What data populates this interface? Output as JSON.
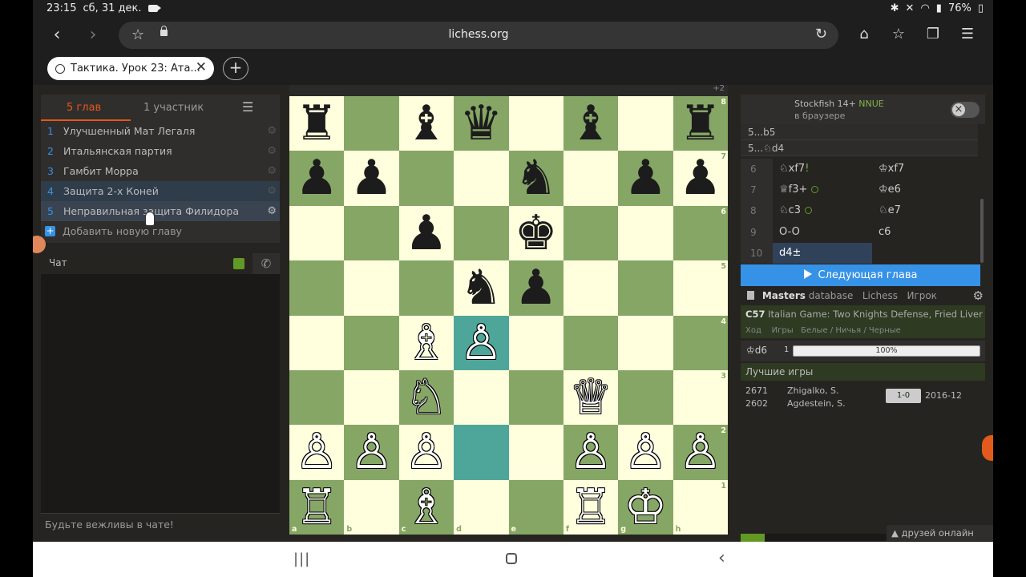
{
  "status": {
    "time": "23:15",
    "date": "сб, 31 дек.",
    "battery": "76%",
    "icons": [
      "bluetooth-icon",
      "mute-icon",
      "wifi-icon",
      "signal-icon",
      "battery-icon"
    ]
  },
  "browser": {
    "url": "lichess.org",
    "tab_title": "Тактика. Урок 23: Ата...",
    "close_glyph": "✕",
    "newtab_glyph": "+"
  },
  "study": {
    "tab_chapters": "5 глав",
    "tab_members": "1 участник",
    "chapters": [
      {
        "num": "1",
        "label": "Улучшенный Мат Легаля"
      },
      {
        "num": "2",
        "label": "Итальянская партия"
      },
      {
        "num": "3",
        "label": "Гамбит Морра"
      },
      {
        "num": "4",
        "label": "Защита 2-х Коней"
      },
      {
        "num": "5",
        "label": "Неправильная защита Филидора"
      }
    ],
    "add_chapter": "Добавить новую главу"
  },
  "chat": {
    "title": "Чат",
    "placeholder": "Будьте вежливы в чате!"
  },
  "board": {
    "top_tag": "+2",
    "pieces": [
      {
        "sq": "a8",
        "p": "♜",
        "c": "b"
      },
      {
        "sq": "c8",
        "p": "♝",
        "c": "b"
      },
      {
        "sq": "d8",
        "p": "♛",
        "c": "b"
      },
      {
        "sq": "f8",
        "p": "♝",
        "c": "b"
      },
      {
        "sq": "h8",
        "p": "♜",
        "c": "b"
      },
      {
        "sq": "a7",
        "p": "♟",
        "c": "b"
      },
      {
        "sq": "b7",
        "p": "♟",
        "c": "b"
      },
      {
        "sq": "e7",
        "p": "♞",
        "c": "b"
      },
      {
        "sq": "g7",
        "p": "♟",
        "c": "b"
      },
      {
        "sq": "h7",
        "p": "♟",
        "c": "b"
      },
      {
        "sq": "c6",
        "p": "♟",
        "c": "b"
      },
      {
        "sq": "e6",
        "p": "♚",
        "c": "b"
      },
      {
        "sq": "d5",
        "p": "♞",
        "c": "b"
      },
      {
        "sq": "e5",
        "p": "♟",
        "c": "b"
      },
      {
        "sq": "c4",
        "p": "♗",
        "c": "w"
      },
      {
        "sq": "d4",
        "p": "♙",
        "c": "w"
      },
      {
        "sq": "c3",
        "p": "♘",
        "c": "w"
      },
      {
        "sq": "f3",
        "p": "♕",
        "c": "w"
      },
      {
        "sq": "a2",
        "p": "♙",
        "c": "w"
      },
      {
        "sq": "b2",
        "p": "♙",
        "c": "w"
      },
      {
        "sq": "c2",
        "p": "♙",
        "c": "w"
      },
      {
        "sq": "f2",
        "p": "♙",
        "c": "w"
      },
      {
        "sq": "g2",
        "p": "♙",
        "c": "w"
      },
      {
        "sq": "h2",
        "p": "♙",
        "c": "w"
      },
      {
        "sq": "a1",
        "p": "♖",
        "c": "w"
      },
      {
        "sq": "c1",
        "p": "♗",
        "c": "w"
      },
      {
        "sq": "f1",
        "p": "♖",
        "c": "w"
      },
      {
        "sq": "g1",
        "p": "♔",
        "c": "w"
      }
    ],
    "highlight": [
      "d4",
      "d2"
    ],
    "files": [
      "a",
      "b",
      "c",
      "d",
      "e",
      "f",
      "g",
      "h"
    ],
    "ranks": [
      "8",
      "7",
      "6",
      "5",
      "4",
      "3",
      "2",
      "1"
    ]
  },
  "engine": {
    "name": "Stockfish 14+",
    "nnue": "NNUE",
    "sub": "в браузере"
  },
  "variations": [
    "5...b5",
    "5...♘d4"
  ],
  "moves": [
    {
      "n": "6",
      "w": "♘xf7",
      "w_ann": "!",
      "b": "♔xf7"
    },
    {
      "n": "7",
      "w": "♕f3+",
      "w_circ": true,
      "b": "♔e6"
    },
    {
      "n": "8",
      "w": "♘c3",
      "w_circ": true,
      "b": "♘e7"
    },
    {
      "n": "9",
      "w": "O-O",
      "b": "c6"
    },
    {
      "n": "10",
      "w": "d4±",
      "b": ""
    }
  ],
  "next_chapter": "Следующая глава",
  "explorer": {
    "tab_masters": "Masters",
    "tab_database": "database",
    "tab_lichess": "Lichess",
    "tab_player": "Игрок",
    "eco": "C57",
    "opening": "Italian Game: Two Knights Defense, Fried Liver A...",
    "col_move": "Ход",
    "col_games": "Игры",
    "col_results": "Белые / Ничья / Черные",
    "row_move": "♔d6",
    "row_count": "1",
    "row_pct": "100%",
    "top_games": "Лучшие игры",
    "game": {
      "white_rating": "2671",
      "black_rating": "2602",
      "white": "Zhigalko, S.",
      "black": "Agdestein, S.",
      "result": "1-0",
      "date": "2016-12"
    }
  },
  "friends": "друзей онлайн"
}
